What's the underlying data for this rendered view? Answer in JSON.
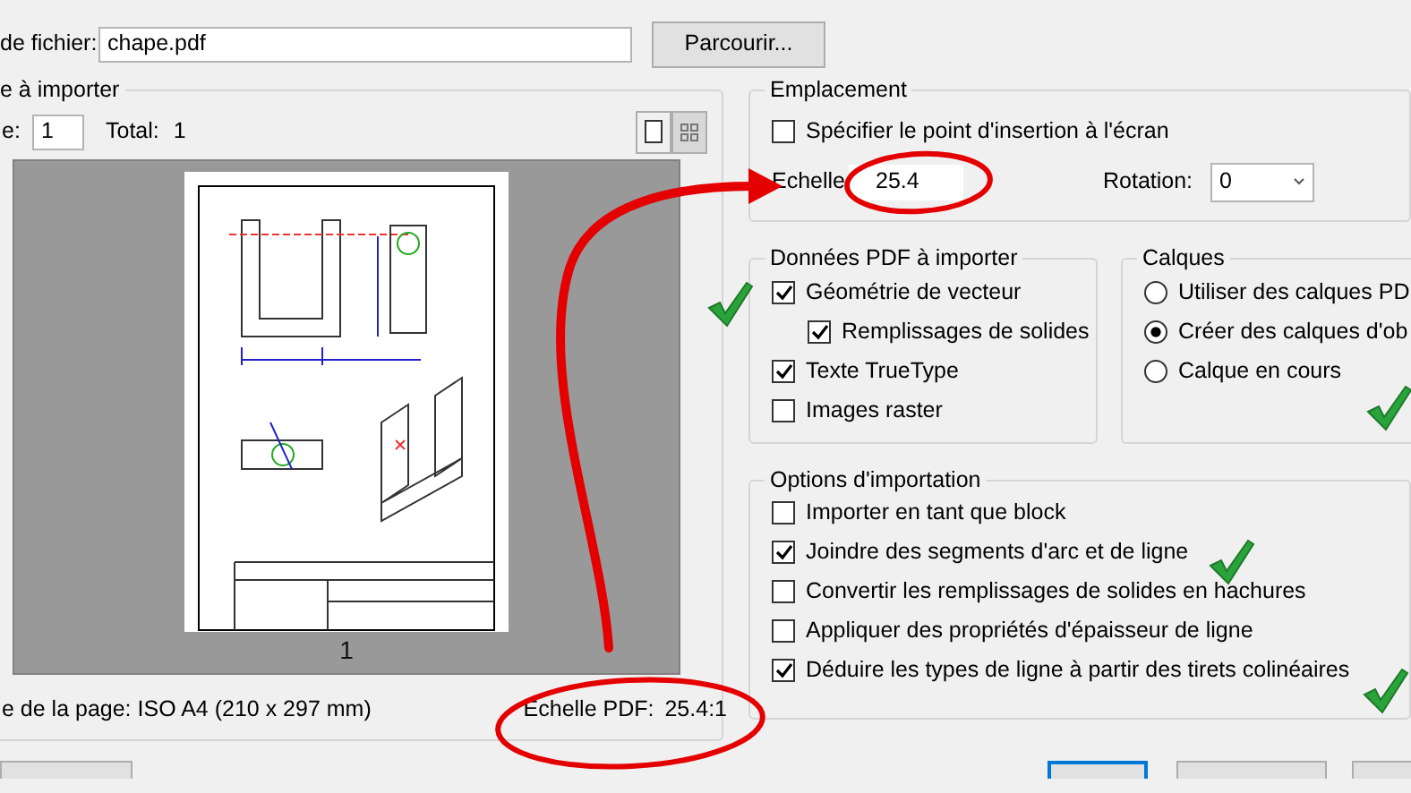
{
  "file": {
    "label": "de fichier:",
    "value": "chape.pdf",
    "browse": "Parcourir..."
  },
  "pages": {
    "title": "e à importer",
    "page_label": "e:",
    "page_value": "1",
    "total_label": "Total:",
    "total_value": "1",
    "view_modes": [
      {
        "kind": "single",
        "selected": false
      },
      {
        "kind": "grid",
        "selected": true
      }
    ],
    "page_number": "1",
    "page_size": "e de la page: ISO A4 (210 x 297 mm)",
    "pdf_scale_label": "Echelle PDF:",
    "pdf_scale_value": "25.4:1"
  },
  "placement": {
    "title": "Emplacement",
    "options": [
      {
        "label": "Spécifier le point d'insertion à l'écran",
        "checked": false
      }
    ],
    "scale_label": "Echelle",
    "scale_value": "25.4",
    "rotation_label": "Rotation:",
    "rotation_value": "0"
  },
  "pdf_data": {
    "title": "Données PDF à importer",
    "options": [
      {
        "label": "Géométrie de vecteur",
        "checked": true,
        "children": [
          {
            "label": "Remplissages de solides",
            "checked": true
          }
        ]
      },
      {
        "label": "Texte TrueType",
        "checked": true
      },
      {
        "label": "Images raster",
        "checked": false
      }
    ]
  },
  "layers": {
    "title": "Calques",
    "options": [
      {
        "label": "Utiliser des calques PD",
        "selected": false
      },
      {
        "label": "Créer des calques d'ob",
        "selected": true
      },
      {
        "label": "Calque en cours",
        "selected": false
      }
    ]
  },
  "import_options": {
    "title": "Options d'importation",
    "options": [
      {
        "label": "Importer en tant que block",
        "checked": false
      },
      {
        "label": "Joindre des segments d'arc et de ligne",
        "checked": true
      },
      {
        "label": "Convertir les remplissages de solides en hachures",
        "checked": false
      },
      {
        "label": "Appliquer des propriétés d'épaisseur de ligne",
        "checked": false
      },
      {
        "label": "Déduire les types de ligne à partir des tirets colinéaires",
        "checked": true
      }
    ]
  },
  "bottom_buttons": [
    {
      "default": false
    },
    {
      "default": true
    },
    {
      "default": false
    },
    {
      "default": false
    }
  ],
  "annotations": [
    {
      "kind": "arrow"
    },
    {
      "kind": "ellipse"
    },
    {
      "kind": "ellipse"
    },
    {
      "kind": "check"
    },
    {
      "kind": "check"
    },
    {
      "kind": "check"
    },
    {
      "kind": "check"
    }
  ]
}
